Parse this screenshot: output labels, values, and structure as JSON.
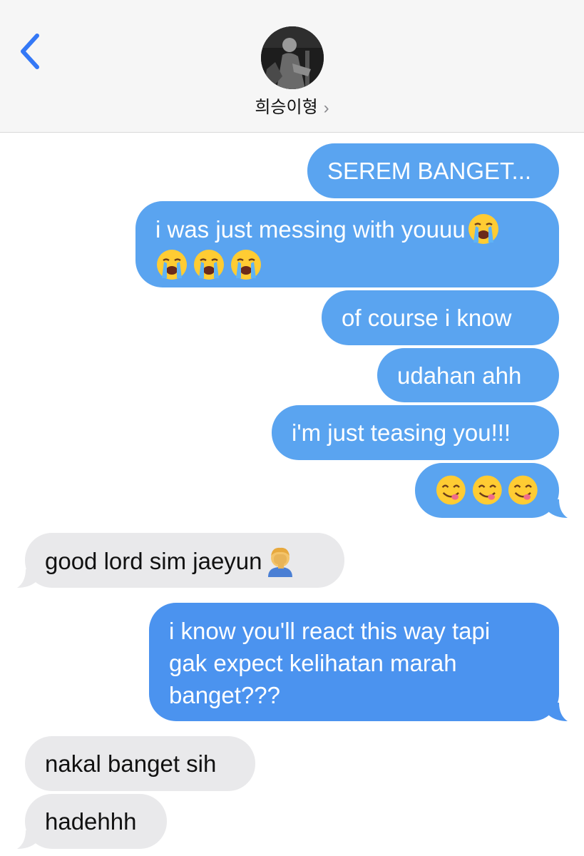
{
  "header": {
    "contact_name": "희승이형",
    "chevron": "›"
  },
  "icons": {
    "back": "chevron-left-icon",
    "cry": "loudly-crying-face-icon",
    "yum": "face-savoring-food-icon",
    "facepalm": "person-facepalming-icon"
  },
  "colors": {
    "outgoing": "#5aa4f0",
    "incoming": "#e9e9eb",
    "accent": "#3478f6"
  },
  "messages": [
    {
      "dir": "out",
      "text": "SEREM BANGET..."
    },
    {
      "dir": "out",
      "text": "i was just messing with youuu"
    },
    {
      "dir": "out",
      "text": "of course i know"
    },
    {
      "dir": "out",
      "text": "udahan ahh"
    },
    {
      "dir": "out",
      "text": "i'm just teasing you!!!"
    },
    {
      "dir": "out",
      "text": ""
    },
    {
      "dir": "in",
      "text": "good lord sim jaeyun"
    },
    {
      "dir": "out",
      "lines": [
        "i know you'll react this way tapi",
        "gak expect kelihatan marah",
        "banget???"
      ]
    },
    {
      "dir": "in",
      "text": "nakal banget sih"
    },
    {
      "dir": "in",
      "text": "hadehhh"
    }
  ]
}
